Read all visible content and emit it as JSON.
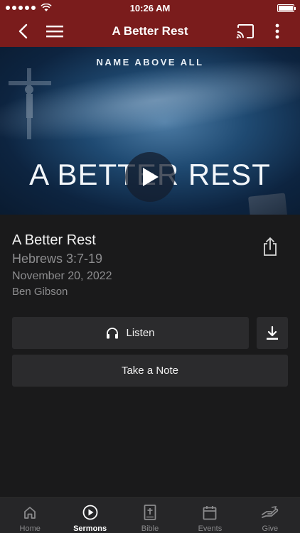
{
  "status_bar": {
    "time": "10:26 AM",
    "signal_dots": 5
  },
  "nav": {
    "title": "A Better Rest",
    "back_icon": "chevron-left-icon",
    "menu_icon": "hamburger-icon",
    "cast_icon": "cast-icon",
    "more_icon": "more-vertical-icon"
  },
  "hero": {
    "series": "NAME ABOVE ALL",
    "title": "A BETTER REST"
  },
  "sermon": {
    "title": "A Better Rest",
    "scripture": "Hebrews 3:7-19",
    "date": "November 20, 2022",
    "speaker": "Ben Gibson"
  },
  "actions": {
    "listen_label": "Listen",
    "note_label": "Take a Note"
  },
  "tabs": [
    {
      "label": "Home",
      "icon": "home-icon",
      "active": false
    },
    {
      "label": "Sermons",
      "icon": "play-circle-icon",
      "active": true
    },
    {
      "label": "Bible",
      "icon": "bible-icon",
      "active": false
    },
    {
      "label": "Events",
      "icon": "calendar-icon",
      "active": false
    },
    {
      "label": "Give",
      "icon": "give-hand-icon",
      "active": false
    }
  ],
  "colors": {
    "brand": "#7a1c1c",
    "background": "#1a1a1b",
    "button": "#2b2b2d",
    "muted_text": "#8d8d8f"
  }
}
